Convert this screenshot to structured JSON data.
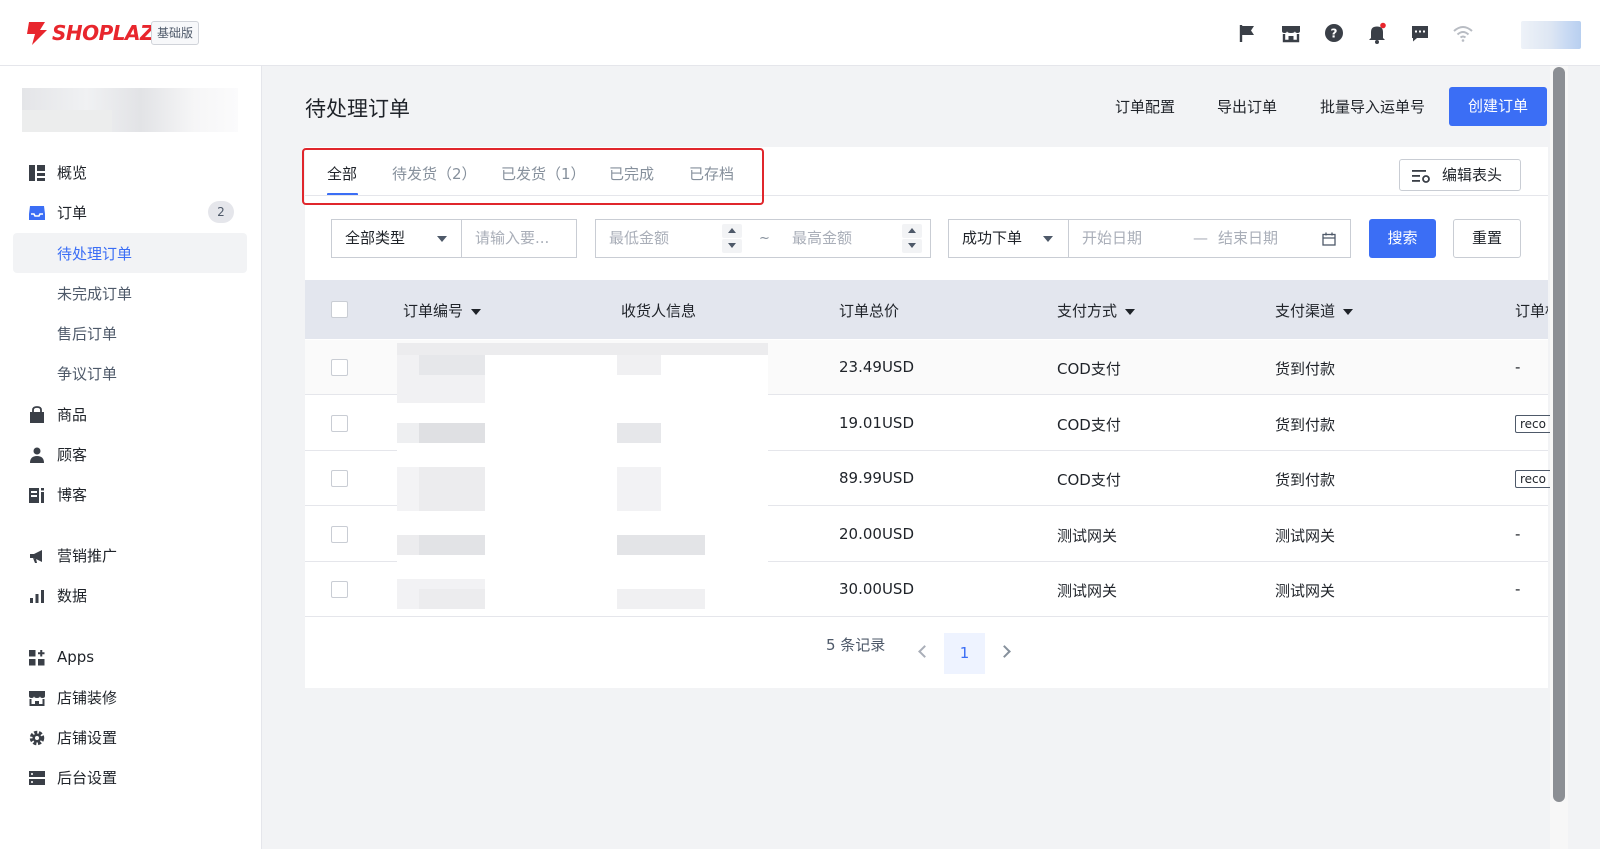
{
  "topbar": {
    "logo_text": "SHOPLAZZA",
    "edition": "基础版",
    "brand_color": "#e8262d",
    "icons": [
      "flag-icon",
      "store-icon",
      "help-icon",
      "bell-icon",
      "message-icon",
      "wifi-icon"
    ]
  },
  "sidebar": {
    "items": [
      {
        "label": "概览",
        "icon": "overview-icon"
      },
      {
        "label": "订单",
        "icon": "inbox-icon",
        "badge": "2"
      },
      {
        "label": "待处理订单",
        "sub": true,
        "active": true
      },
      {
        "label": "未完成订单",
        "sub": true
      },
      {
        "label": "售后订单",
        "sub": true
      },
      {
        "label": "争议订单",
        "sub": true
      },
      {
        "label": "商品",
        "icon": "bag-icon"
      },
      {
        "label": "顾客",
        "icon": "user-icon"
      },
      {
        "label": "博客",
        "icon": "blog-icon"
      },
      {
        "label": "营销推广",
        "icon": "megaphone-icon"
      },
      {
        "label": "数据",
        "icon": "chart-icon"
      },
      {
        "label": "Apps",
        "icon": "apps-icon"
      },
      {
        "label": "店铺装修",
        "icon": "storefront-icon"
      },
      {
        "label": "店铺设置",
        "icon": "gear-icon"
      },
      {
        "label": "后台设置",
        "icon": "server-icon"
      }
    ]
  },
  "header": {
    "title": "待处理订单",
    "actions": [
      "订单配置",
      "导出订单",
      "批量导入运单号"
    ],
    "primary": "创建订单",
    "accent": "#3b6ef5"
  },
  "tabs": [
    {
      "label": "全部",
      "active": true
    },
    {
      "label": "待发货（2）"
    },
    {
      "label": "已发货（1）"
    },
    {
      "label": "已完成"
    },
    {
      "label": "已存档"
    }
  ],
  "edit_header_button": "编辑表头",
  "filters": {
    "type_select": "全部类型",
    "keyword_placeholder": "请输入要...",
    "min_amount_placeholder": "最低金额",
    "range_sep": "~",
    "max_amount_placeholder": "最高金额",
    "status_select": "成功下单",
    "start_date_placeholder": "开始日期",
    "date_sep": "—",
    "end_date_placeholder": "结束日期",
    "search": "搜索",
    "reset": "重置"
  },
  "table": {
    "columns": [
      "订单编号",
      "收货人信息",
      "订单总价",
      "支付方式",
      "支付渠道",
      "订单标"
    ],
    "rows": [
      {
        "total": "23.49USD",
        "pay_method": "COD支付",
        "channel": "货到付款",
        "tag": "-"
      },
      {
        "total": "19.01USD",
        "pay_method": "COD支付",
        "channel": "货到付款",
        "tag": "reco"
      },
      {
        "total": "89.99USD",
        "pay_method": "COD支付",
        "channel": "货到付款",
        "tag": "reco"
      },
      {
        "total": "20.00USD",
        "pay_method": "测试网关",
        "channel": "测试网关",
        "tag": "-"
      },
      {
        "total": "30.00USD",
        "pay_method": "测试网关",
        "channel": "测试网关",
        "tag": "-"
      }
    ]
  },
  "pagination": {
    "records": "5 条记录",
    "current_page": "1"
  }
}
